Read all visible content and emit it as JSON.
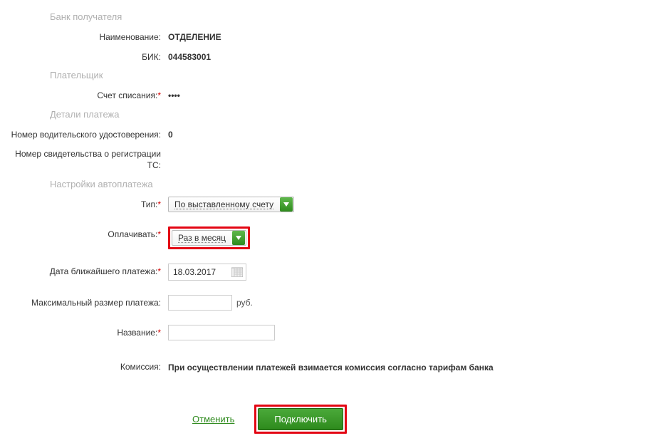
{
  "sections": {
    "bank": "Банк получателя",
    "payer": "Плательщик",
    "details": "Детали платежа",
    "auto": "Настройки автоплатежа"
  },
  "labels": {
    "name": "Наименование:",
    "bik": "БИК:",
    "account": "Счет списания:",
    "license": "Номер водительского удостоверения:",
    "reg": "Номер свидетельства о регистрации ТС:",
    "type": "Тип:",
    "pay": "Оплачивать:",
    "date": "Дата ближайшего платежа:",
    "max": "Максимальный размер платежа:",
    "title": "Название:",
    "commission": "Комиссия:"
  },
  "values": {
    "name": "ОТДЕЛЕНИЕ",
    "bik": "044583001",
    "account": "••••",
    "license": "0",
    "reg": "",
    "type_select": "По выставленному счету",
    "pay_select": "Раз в месяц",
    "date": "18.03.2017",
    "max": "",
    "title": "",
    "commission": "При осуществлении платежей взимается комиссия согласно тарифам банка",
    "rub": "руб."
  },
  "actions": {
    "cancel": "Отменить",
    "submit": "Подключить"
  }
}
